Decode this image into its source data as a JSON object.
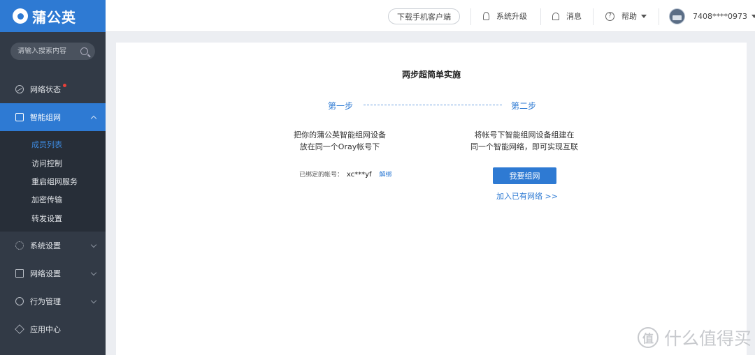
{
  "brand": {
    "name": "蒲公英"
  },
  "search": {
    "placeholder": "请输入搜索内容"
  },
  "sidebar": {
    "items": [
      {
        "label": "网络状态",
        "icon": "network-status-icon",
        "has_dot": true
      },
      {
        "label": "智能组网",
        "icon": "smart-network-icon",
        "expanded": true,
        "active": true
      },
      {
        "label": "系统设置",
        "icon": "gear-icon"
      },
      {
        "label": "网络设置",
        "icon": "document-icon"
      },
      {
        "label": "行为管理",
        "icon": "behavior-icon"
      },
      {
        "label": "应用中心",
        "icon": "cube-icon"
      }
    ],
    "sub_items": [
      {
        "label": "成员列表",
        "current": true
      },
      {
        "label": "访问控制"
      },
      {
        "label": "重启组网服务"
      },
      {
        "label": "加密传输"
      },
      {
        "label": "转发设置"
      }
    ]
  },
  "topbar": {
    "download_label": "下载手机客户端",
    "upgrade_label": "系统升级",
    "messages_label": "消息",
    "help_label": "帮助",
    "account_label": "7408****0973"
  },
  "main": {
    "title": "两步超简单实施",
    "step1_label": "第一步",
    "step2_label": "第二步",
    "step1_desc_line1": "把你的蒲公英智能组网设备",
    "step1_desc_line2": "放在同一个Oray帐号下",
    "step2_desc_line1": "将帐号下智能组网设备组建在",
    "step2_desc_line2": "同一个智能网络，即可实现互联",
    "bound_label": "已绑定的帐号：",
    "bound_account": "xc***yf",
    "unbind_label": "解绑",
    "join_button": "我要组网",
    "join_existing": "加入已有网络 >>"
  },
  "watermark": {
    "mark": "值",
    "text": "什么值得买"
  },
  "colors": {
    "accent": "#2e7ad3",
    "sidebar_bg": "#323a46",
    "badge": "#e8403a"
  }
}
